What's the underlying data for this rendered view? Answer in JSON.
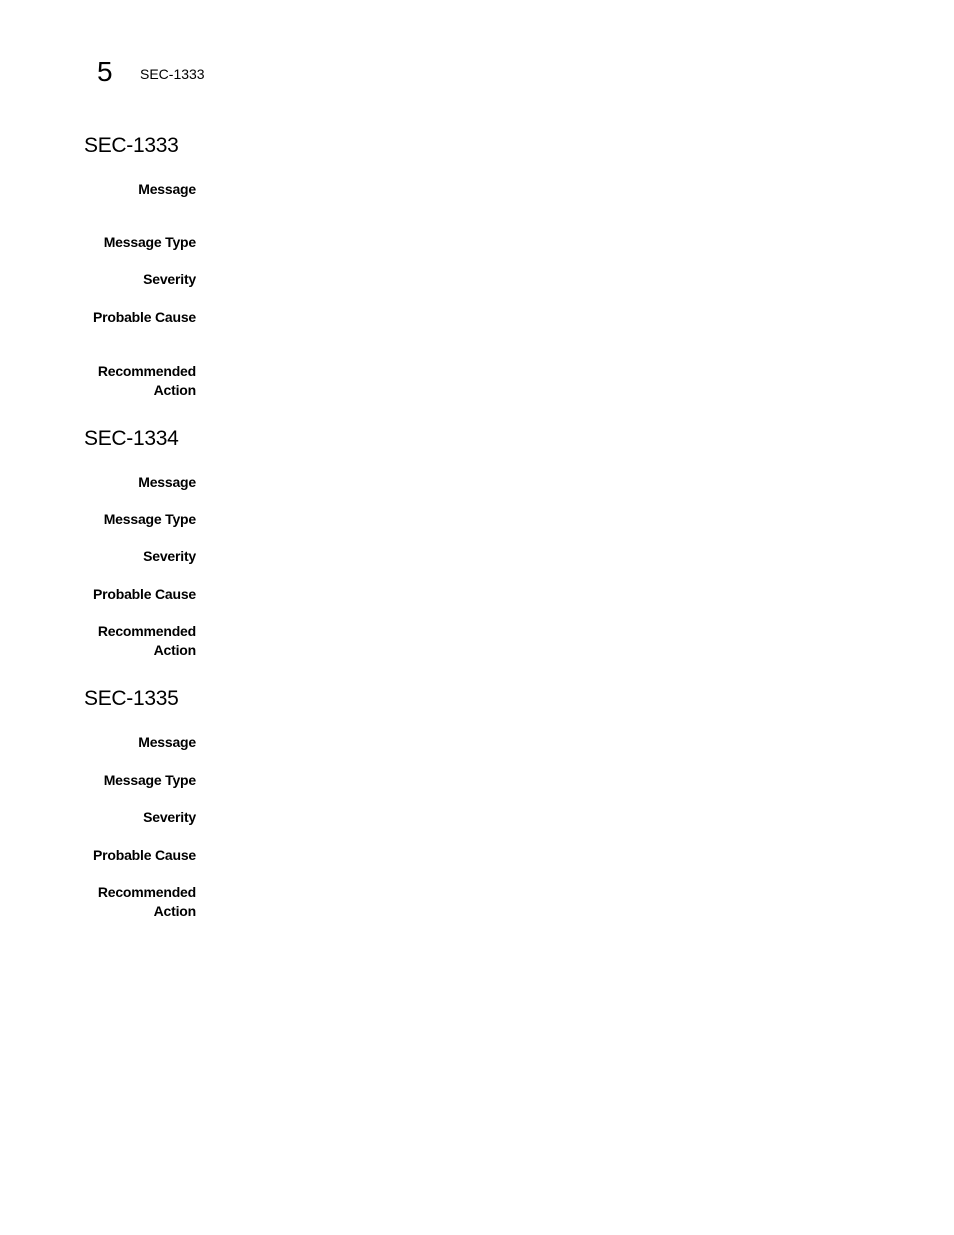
{
  "header": {
    "chapter_number": "5",
    "running_title": "SEC-1333"
  },
  "sections": [
    {
      "title": "SEC-1333",
      "fields": [
        {
          "label": "Message",
          "value": ""
        },
        {
          "label": "Message Type",
          "value": ""
        },
        {
          "label": "Severity",
          "value": ""
        },
        {
          "label": "Probable Cause",
          "value": ""
        },
        {
          "label": "Recommended Action",
          "value": ""
        }
      ]
    },
    {
      "title": "SEC-1334",
      "fields": [
        {
          "label": "Message",
          "value": ""
        },
        {
          "label": "Message Type",
          "value": ""
        },
        {
          "label": "Severity",
          "value": ""
        },
        {
          "label": "Probable Cause",
          "value": ""
        },
        {
          "label": "Recommended Action",
          "value": ""
        }
      ]
    },
    {
      "title": "SEC-1335",
      "fields": [
        {
          "label": "Message",
          "value": ""
        },
        {
          "label": "Message Type",
          "value": ""
        },
        {
          "label": "Severity",
          "value": ""
        },
        {
          "label": "Probable Cause",
          "value": ""
        },
        {
          "label": "Recommended Action",
          "value": ""
        }
      ]
    }
  ]
}
